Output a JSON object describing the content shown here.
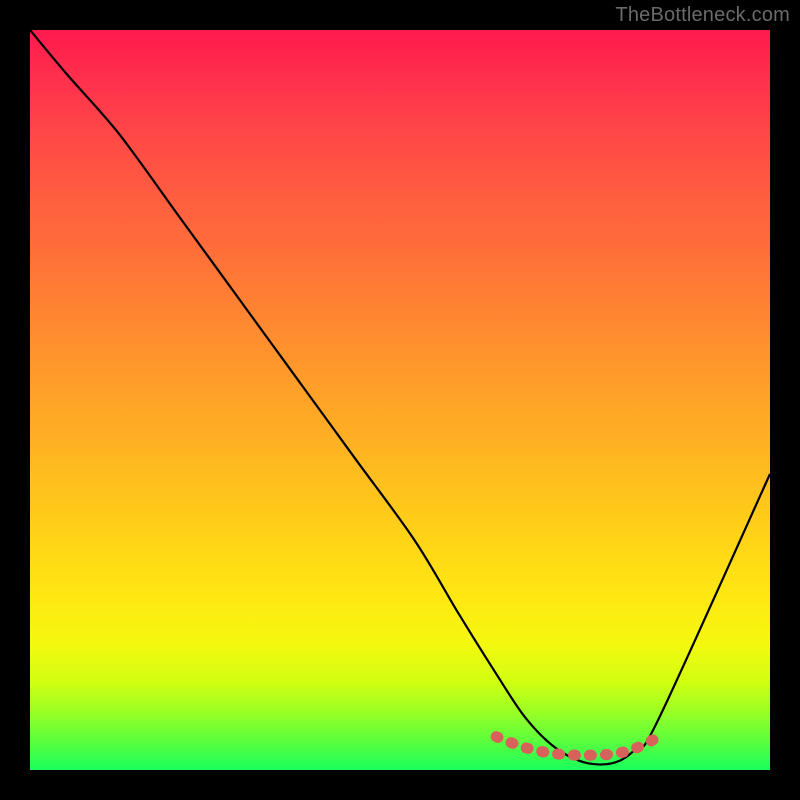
{
  "watermark": "TheBottleneck.com",
  "chart_data": {
    "type": "line",
    "title": "",
    "xlabel": "",
    "ylabel": "",
    "xlim": [
      0,
      100
    ],
    "ylim": [
      0,
      100
    ],
    "series": [
      {
        "name": "bottleneck-curve",
        "x": [
          0,
          5,
          12,
          20,
          28,
          36,
          44,
          52,
          58,
          63,
          67,
          71,
          75,
          79,
          82,
          85,
          100
        ],
        "values": [
          100,
          94,
          86,
          75,
          64,
          53,
          42,
          31,
          21,
          13,
          7,
          3,
          1,
          1,
          3,
          7,
          40
        ]
      },
      {
        "name": "highlight-band",
        "x": [
          63,
          67,
          71,
          75,
          79,
          82,
          85
        ],
        "values": [
          4.5,
          3.0,
          2.2,
          2.0,
          2.2,
          3.0,
          4.5
        ]
      }
    ],
    "highlight_color": "#d9615b",
    "curve_color": "#000000"
  }
}
